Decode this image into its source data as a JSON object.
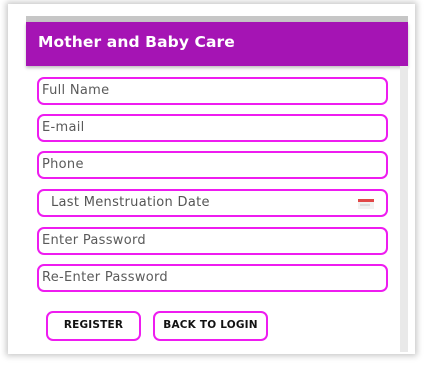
{
  "app_bar": {
    "title": "Mother and Baby Care"
  },
  "form": {
    "full_name": {
      "placeholder": "Full Name"
    },
    "email": {
      "placeholder": "E-mail"
    },
    "phone": {
      "placeholder": "Phone"
    },
    "lmp_date": {
      "placeholder": "Last Menstruation Date",
      "icon": "calendar-icon"
    },
    "password": {
      "placeholder": "Enter Password"
    },
    "confirm_password": {
      "placeholder": "Re-Enter Password"
    }
  },
  "buttons": {
    "register": "REGISTER",
    "back_to_login": "BACK TO LOGIN"
  },
  "colors": {
    "app_bar": "#a514b4",
    "field_border": "#ee1cf0",
    "calendar_accent": "#e14848"
  }
}
